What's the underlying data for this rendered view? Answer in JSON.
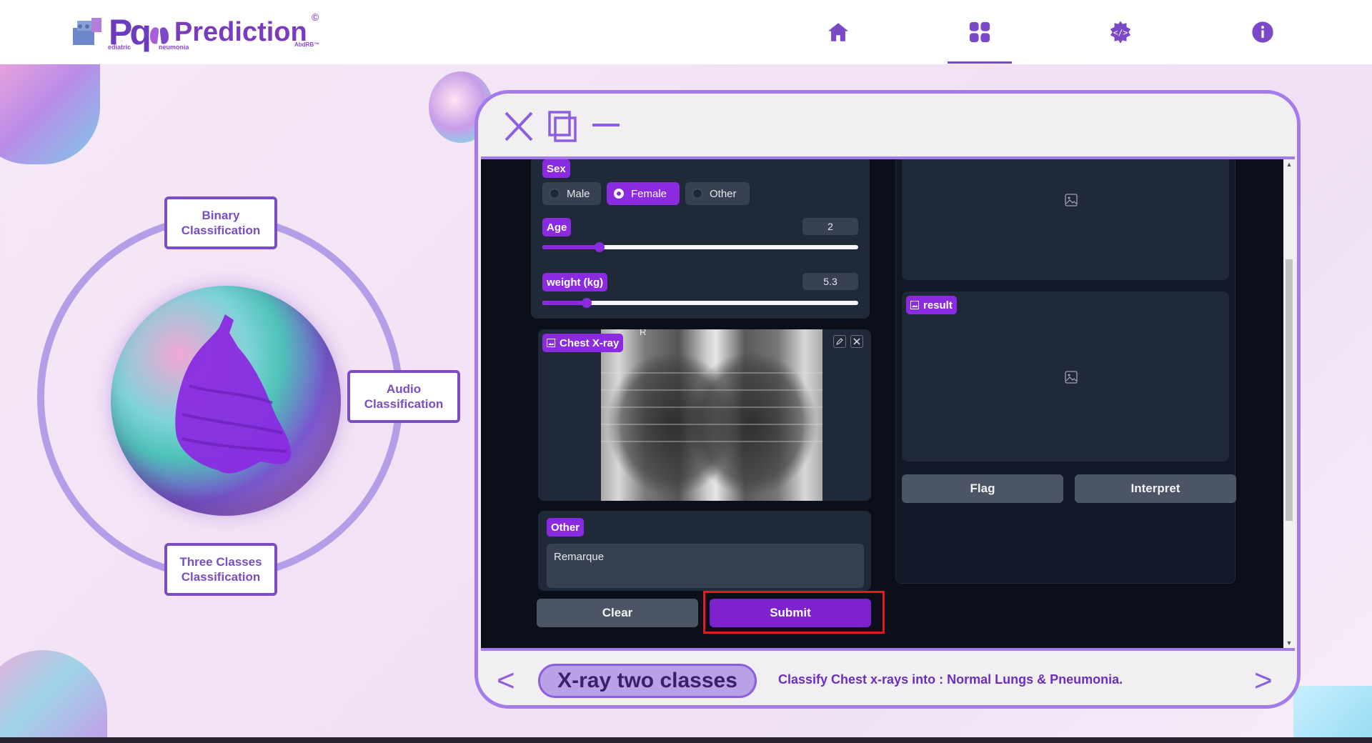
{
  "brand": {
    "pq": "Pq",
    "name": "Prediction",
    "sub_left": "ediatric",
    "sub_right": "neumonia",
    "tagline": "AbdRB™",
    "registered": "©"
  },
  "nav": {
    "items": [
      {
        "icon": "home-icon"
      },
      {
        "icon": "grid-icon"
      },
      {
        "icon": "code-gear-icon"
      },
      {
        "icon": "info-icon"
      }
    ],
    "active_index": 1
  },
  "diagram": {
    "binary": "Binary Classification",
    "audio": "Audio Classification",
    "three": "Three Classes Classification"
  },
  "form": {
    "sex_label": "Sex",
    "sex_options": [
      "Male",
      "Female",
      "Other"
    ],
    "sex_selected": "Female",
    "age_label": "Age",
    "age_value": "2",
    "age_fraction": 0.18,
    "weight_label": "weight (kg)",
    "weight_value": "5.3",
    "weight_fraction": 0.14,
    "xray_label": "Chest X-ray",
    "xray_marker": "R",
    "other_label": "Other",
    "other_value": "Remarque",
    "clear_label": "Clear",
    "submit_label": "Submit"
  },
  "output": {
    "result_label": "result",
    "flag_label": "Flag",
    "interpret_label": "Interpret"
  },
  "footer": {
    "model_name": "X-ray two classes",
    "description": "Classify Chest x-rays into : Normal Lungs & Pneumonia.",
    "prev": "<",
    "next": ">"
  },
  "colors": {
    "accent": "#8a2be2",
    "panel": "#1f2937",
    "frame": "#a47bea",
    "highlight": "#e01b1b"
  }
}
